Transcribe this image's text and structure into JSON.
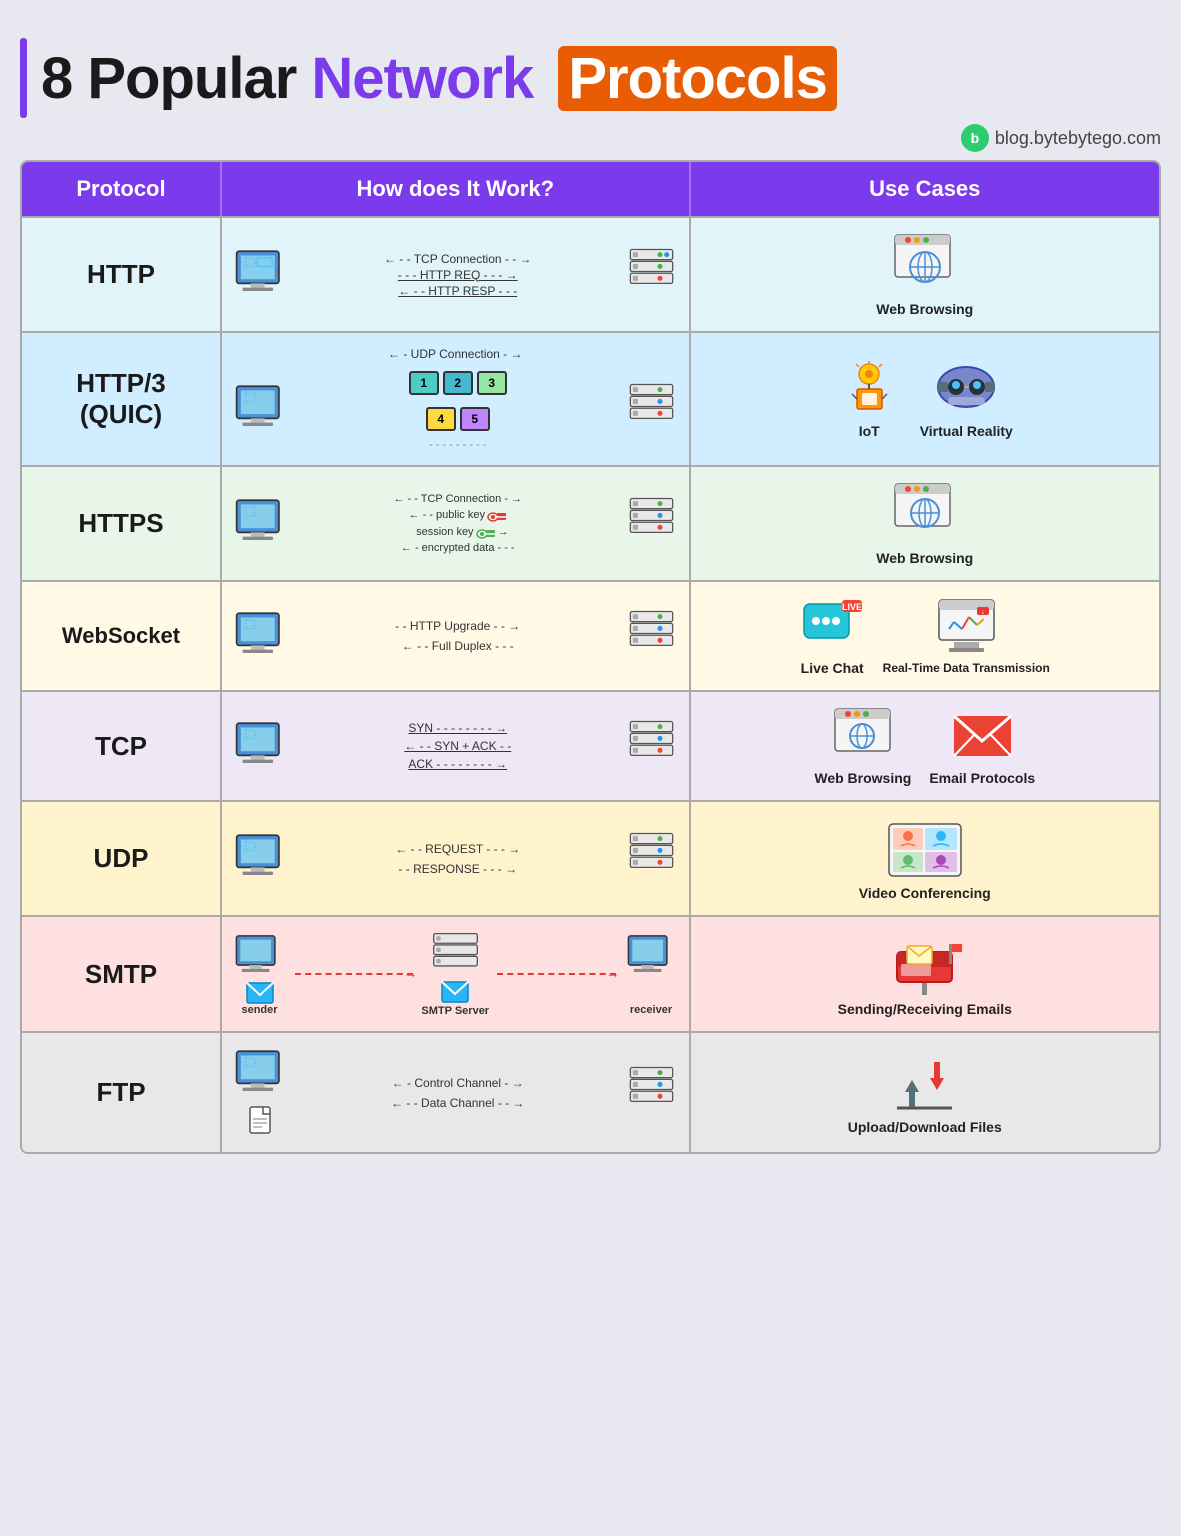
{
  "title": {
    "prefix": "8 Popular ",
    "network": "Network",
    "protocols": "Protocols",
    "brand": "blog.bytebytego.com"
  },
  "header": {
    "col1": "Protocol",
    "col2": "How does It Work?",
    "col3": "Use Cases"
  },
  "rows": [
    {
      "id": "http",
      "name": "HTTP",
      "how": [
        "TCP Connection",
        "HTTP REQ",
        "HTTP RESP"
      ],
      "arrows": [
        "right",
        "right",
        "left"
      ],
      "uses": [
        "Web Browsing"
      ]
    },
    {
      "id": "http3",
      "name": "HTTP/3 (QUIC)",
      "how": [
        "UDP Connection"
      ],
      "uses": [
        "IoT",
        "Virtual Reality"
      ]
    },
    {
      "id": "https",
      "name": "HTTPS",
      "how": [
        "TCP Connection",
        "public key",
        "session key",
        "encrypted data"
      ],
      "uses": [
        "Web Browsing"
      ]
    },
    {
      "id": "websocket",
      "name": "WebSocket",
      "how": [
        "HTTP Upgrade",
        "Full Duplex"
      ],
      "uses": [
        "Live Chat",
        "Real-Time Data Transmission"
      ]
    },
    {
      "id": "tcp",
      "name": "TCP",
      "how": [
        "SYN",
        "SYN + ACK",
        "ACK"
      ],
      "uses": [
        "Web Browsing",
        "Email Protocols"
      ]
    },
    {
      "id": "udp",
      "name": "UDP",
      "how": [
        "REQUEST",
        "RESPONSE"
      ],
      "uses": [
        "Video Conferencing"
      ]
    },
    {
      "id": "smtp",
      "name": "SMTP",
      "how_labels": [
        "sender",
        "SMTP Server",
        "receiver"
      ],
      "uses": [
        "Sending/Receiving Emails"
      ]
    },
    {
      "id": "ftp",
      "name": "FTP",
      "how": [
        "Control Channel",
        "Data Channel"
      ],
      "uses": [
        "Upload/Download Files"
      ]
    }
  ]
}
